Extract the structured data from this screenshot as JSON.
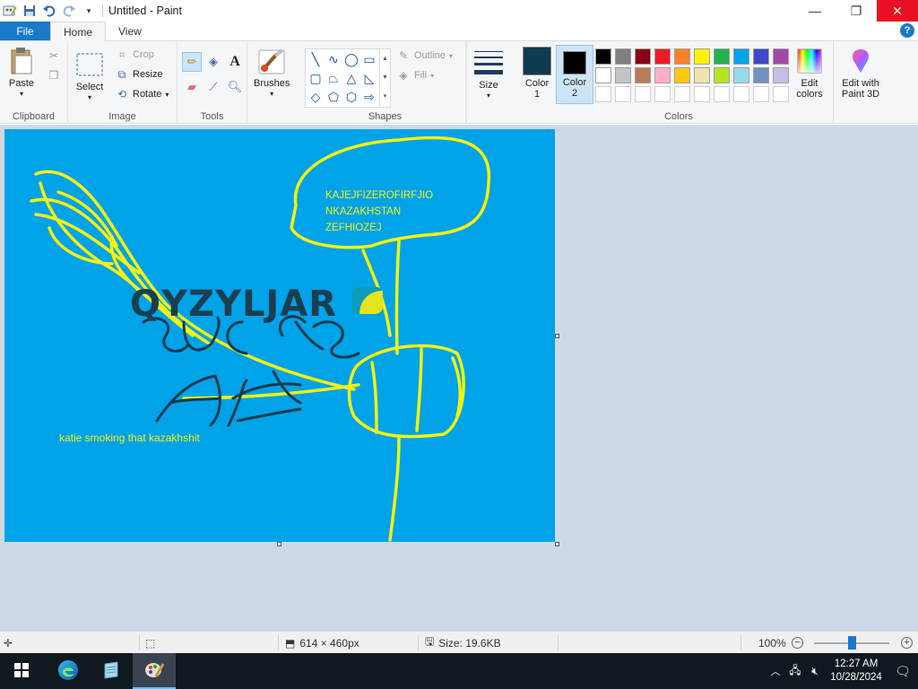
{
  "window": {
    "title": "Untitled - Paint",
    "quick_access": [
      "paint-app-icon",
      "save-icon",
      "undo-icon",
      "redo-icon",
      "customize-dropdown-icon"
    ],
    "controls": [
      "minimize-icon",
      "restore-icon",
      "close-icon"
    ]
  },
  "tabs": {
    "file": "File",
    "home": "Home",
    "view": "View"
  },
  "ribbon": {
    "clipboard": {
      "label": "Clipboard",
      "paste": "Paste",
      "cut_icon": "scissors-icon",
      "copy_icon": "copy-icon"
    },
    "image": {
      "label": "Image",
      "select": "Select",
      "crop": "Crop",
      "resize": "Resize",
      "rotate": "Rotate"
    },
    "tools": {
      "label": "Tools",
      "icons": [
        "pencil-icon",
        "fill-bucket-icon",
        "text-icon",
        "eraser-icon",
        "color-picker-icon",
        "magnifier-icon"
      ]
    },
    "brushes": {
      "label": "Brushes"
    },
    "shapes": {
      "label": "Shapes",
      "outline": "Outline",
      "fill": "Fill"
    },
    "size": {
      "label": "Size"
    },
    "colors": {
      "label": "Colors",
      "color1": "Color\n1",
      "color1_label_a": "Color",
      "color1_label_b": "1",
      "color2_label_a": "Color",
      "color2_label_b": "2",
      "color1_value": "#0f3b4f",
      "color2_value": "#000000",
      "edit_colors_a": "Edit",
      "edit_colors_b": "colors",
      "palette_row1": [
        "#000000",
        "#7f7f7f",
        "#880015",
        "#ed1c24",
        "#ff7f27",
        "#fff200",
        "#22b14c",
        "#00a2e8",
        "#3f48cc",
        "#a349a4"
      ],
      "palette_row2": [
        "#ffffff",
        "#c3c3c3",
        "#b97a57",
        "#ffaec9",
        "#ffc90e",
        "#efe4b0",
        "#b5e61d",
        "#99d9ea",
        "#7092be",
        "#c8bfe7"
      ]
    },
    "paint3d": {
      "label_a": "Edit with",
      "label_b": "Paint 3D"
    }
  },
  "canvas": {
    "background": "#00a2e8",
    "texts": {
      "bubble_line1": "KAJEJFIZEROFIRFJIO",
      "bubble_line2": "NKAZAKHSTAN",
      "bubble_line3": "ZEFHIOZEJ",
      "logo": "QYZYLJAR",
      "caption": "katie smoking that kazakhshit"
    }
  },
  "statusbar": {
    "dimensions": "614 × 460px",
    "size": "Size: 19.6KB",
    "zoom": "100%",
    "zoom_level": 0.5
  },
  "taskbar": {
    "time": "12:27 AM",
    "date": "10/28/2024",
    "apps": [
      "windows-start-icon",
      "edge-icon",
      "notepad-icon",
      "paint-icon"
    ]
  }
}
